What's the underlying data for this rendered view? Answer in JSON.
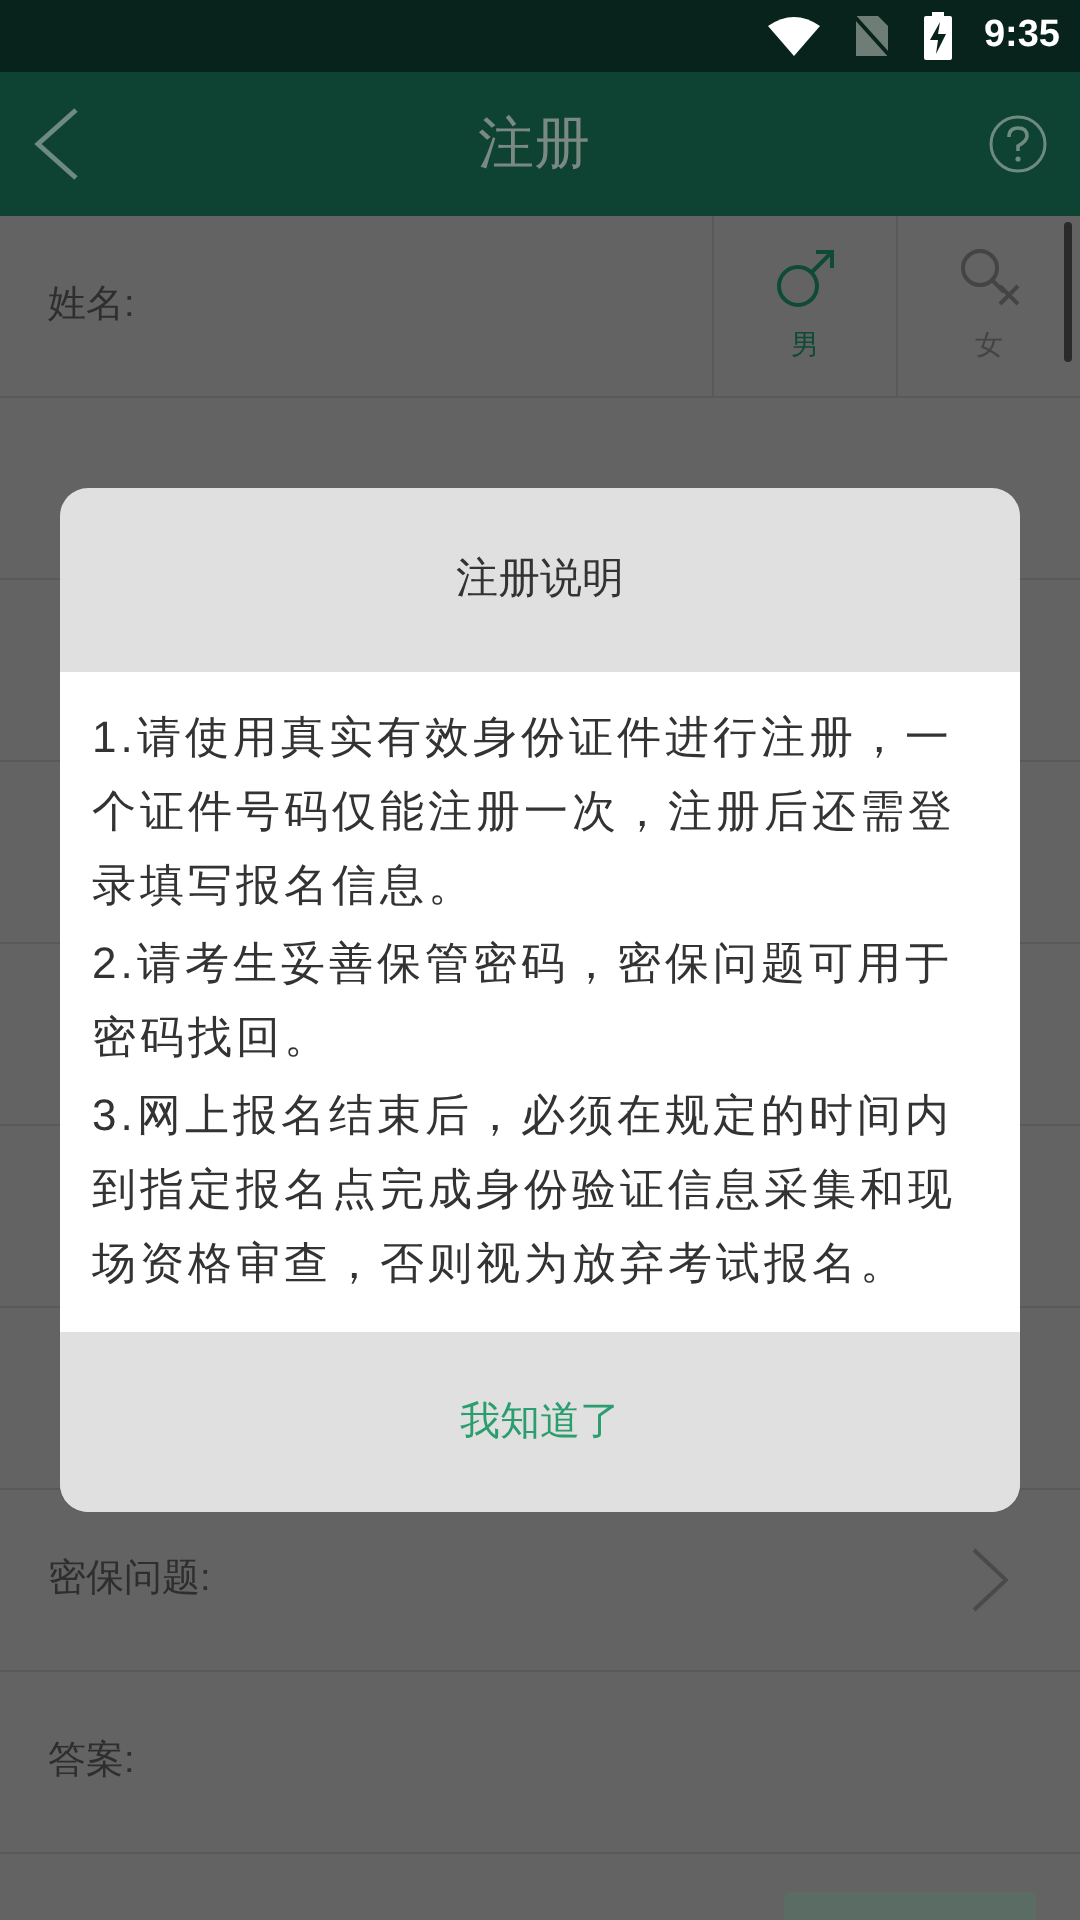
{
  "status_bar": {
    "time": "9:35"
  },
  "header": {
    "title": "注册"
  },
  "name_row": {
    "label": "姓名:"
  },
  "gender_options": [
    {
      "label": "男",
      "kind": "male",
      "selected": true
    },
    {
      "label": "女",
      "kind": "female",
      "selected": false
    }
  ],
  "rows": [
    {
      "label": "密保问题:",
      "kind": "select"
    },
    {
      "label": "答案:",
      "kind": "input"
    }
  ],
  "dialog": {
    "title": "注册说明",
    "paragraphs": [
      "1.请使用真实有效身份证件进行注册，一个证件号码仅能注册一次，注册后还需登录填写报名信息。",
      "2.请考生妥善保管密码，密保问题可用于密码找回。",
      "3.网上报名结束后，必须在规定的时间内到指定报名点完成身份验证信息采集和现场资格审查，否则视为放弃考试报名。"
    ],
    "button": "我知道了"
  }
}
